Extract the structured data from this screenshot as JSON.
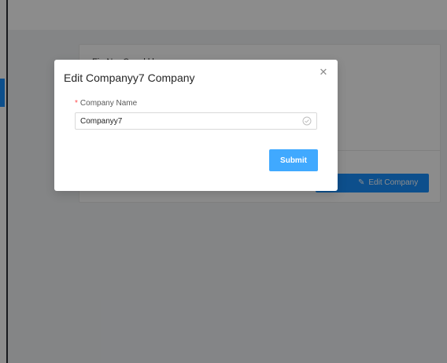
{
  "background": {
    "card_text": "Fie  Nar        Com   l   l  l",
    "edit_company_label": "Edit Company",
    "edit_icon": "edit-icon"
  },
  "modal": {
    "title": "Edit Companyy7 Company",
    "close_icon": "close-icon",
    "field": {
      "required_mark": "*",
      "label": "Company Name",
      "value": "Companyy7",
      "status_icon": "check-circle-icon"
    },
    "submit_label": "Submit"
  },
  "colors": {
    "primary": "#1890ff",
    "submit": "#40a9ff",
    "required": "#ff4d4f",
    "mask": "rgba(0,0,0,0.45)"
  }
}
